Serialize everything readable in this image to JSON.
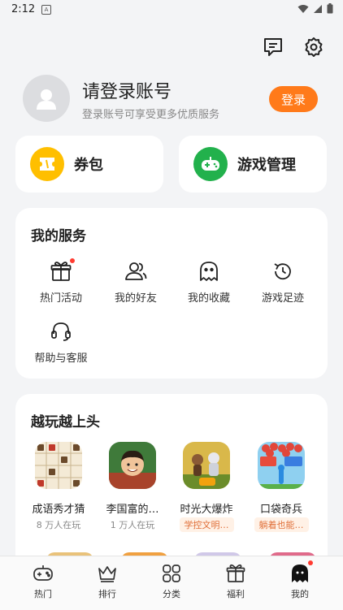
{
  "status": {
    "time": "2:12",
    "notif_letter": "A"
  },
  "profile": {
    "name": "请登录账号",
    "subtitle": "登录账号可享受更多优质服务",
    "login_label": "登录"
  },
  "quick": [
    {
      "label": "券包",
      "icon": "ticket-icon",
      "color": "#ffbf00"
    },
    {
      "label": "游戏管理",
      "icon": "gamepad-icon",
      "color": "#22b14c"
    }
  ],
  "services": {
    "title": "我的服务",
    "items": [
      {
        "label": "热门活动",
        "icon": "gift-icon",
        "badge": true
      },
      {
        "label": "我的好友",
        "icon": "friends-icon",
        "badge": false
      },
      {
        "label": "我的收藏",
        "icon": "ghost-icon",
        "badge": false
      },
      {
        "label": "游戏足迹",
        "icon": "history-icon",
        "badge": false
      },
      {
        "label": "帮助与客服",
        "icon": "headset-icon",
        "badge": false
      }
    ]
  },
  "games": {
    "title": "越玩越上头",
    "items": [
      {
        "name": "成语秀才猜",
        "sub": "8 万人在玩"
      },
      {
        "name": "李国富的…",
        "sub": "1 万人在玩"
      },
      {
        "name": "时光大爆炸",
        "tag": "学控文明…"
      },
      {
        "name": "口袋奇兵",
        "tag": "躺着也能…"
      }
    ]
  },
  "tabs": [
    {
      "label": "热门",
      "icon": "gamepad-outline-icon"
    },
    {
      "label": "排行",
      "icon": "crown-icon"
    },
    {
      "label": "分类",
      "icon": "grid-icon"
    },
    {
      "label": "福利",
      "icon": "gift-box-icon"
    },
    {
      "label": "我的",
      "icon": "ghost-filled-icon",
      "badge": true
    }
  ],
  "colors": {
    "accent": "#ff7a1a",
    "badge": "#ff3b30"
  }
}
